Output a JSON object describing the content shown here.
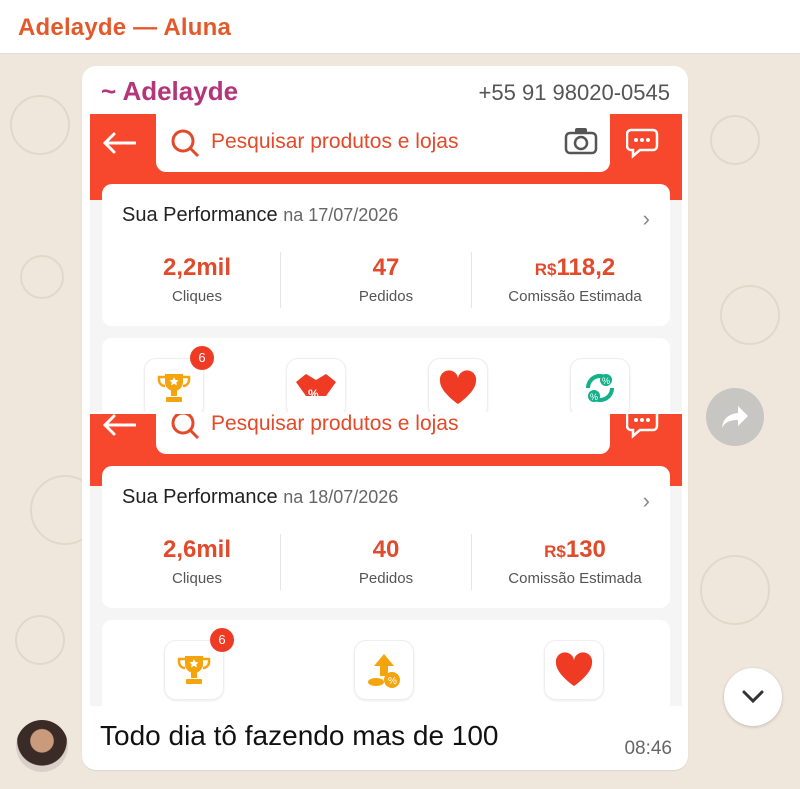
{
  "header": {
    "title": "Adelayde — Aluna"
  },
  "message": {
    "sender": "~ Adelayde",
    "phone": "+55 91 98020-0545",
    "text": "Todo dia tô fazendo mas de 100",
    "time": "08:46"
  },
  "shots": [
    {
      "search_placeholder": "Pesquisar produtos e lojas",
      "perf_title": "Sua Performance",
      "perf_date": "na 17/07/2026",
      "metrics": [
        {
          "value": "2,2mil",
          "label": "Cliques"
        },
        {
          "value": "47",
          "label": "Pedidos"
        },
        {
          "currency": "R$",
          "value": "118,2",
          "label": "Comissão Estimada"
        }
      ],
      "badge": "6"
    },
    {
      "search_placeholder": "Pesquisar produtos e lojas",
      "perf_title": "Sua Performance",
      "perf_date": "na 18/07/2026",
      "metrics": [
        {
          "value": "2,6mil",
          "label": "Cliques"
        },
        {
          "value": "40",
          "label": "Pedidos"
        },
        {
          "currency": "R$",
          "value": "130",
          "label": "Comissão Estimada"
        }
      ],
      "badge": "6"
    }
  ],
  "colors": {
    "accent": "#e4592b",
    "shopee_red": "#f7472c",
    "sender": "#b3357a"
  }
}
